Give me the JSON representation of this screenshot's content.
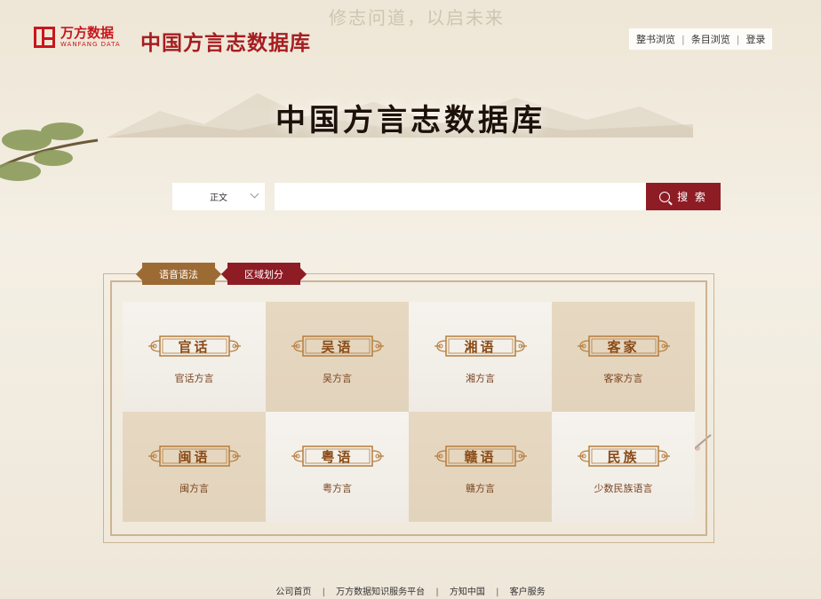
{
  "logo": {
    "cn": "万方数据",
    "en": "WANFANG DATA"
  },
  "site_title": "中国方言志数据库",
  "background_text": "修志问道，以启未来",
  "topnav": {
    "items": [
      "整书浏览",
      "条目浏览",
      "登录"
    ]
  },
  "main_title": "中国方言志数据库",
  "search": {
    "field_select": "正文",
    "placeholder": "",
    "button_label": "搜 索"
  },
  "tabs": [
    {
      "label": "语音语法"
    },
    {
      "label": "区域划分"
    }
  ],
  "categories": [
    {
      "plaque": "官话",
      "label": "官话方言"
    },
    {
      "plaque": "吴语",
      "label": "吴方言"
    },
    {
      "plaque": "湘语",
      "label": "湘方言"
    },
    {
      "plaque": "客家",
      "label": "客家方言"
    },
    {
      "plaque": "闽语",
      "label": "闽方言"
    },
    {
      "plaque": "粤语",
      "label": "粤方言"
    },
    {
      "plaque": "赣语",
      "label": "赣方言"
    },
    {
      "plaque": "民族",
      "label": "少数民族语言"
    }
  ],
  "footer": {
    "links": [
      "公司首页",
      "万方数据知识服务平台",
      "方知中国",
      "客户服务"
    ]
  },
  "colors": {
    "brand_red": "#8e1c25",
    "gold": "#9c6a33",
    "logo_red": "#c8161d"
  }
}
